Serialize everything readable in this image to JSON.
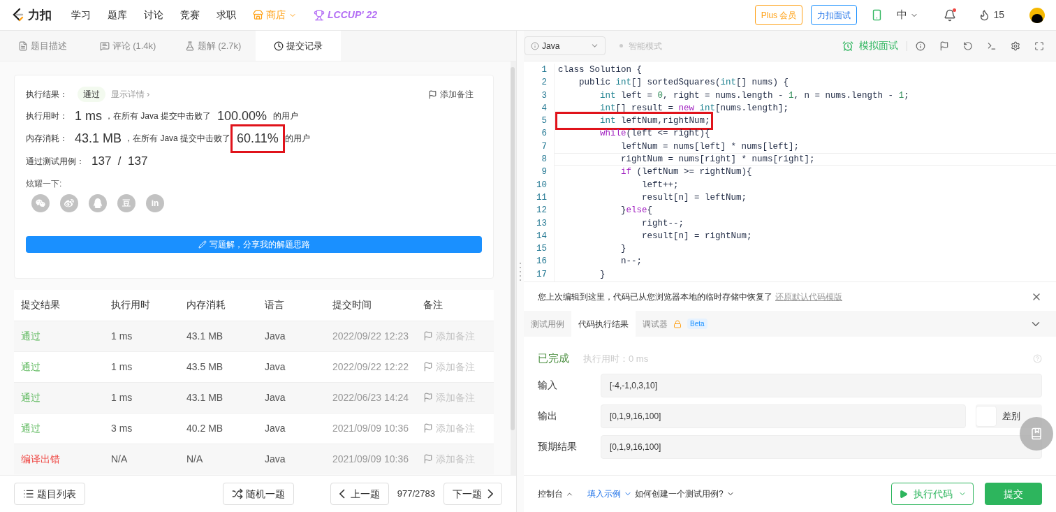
{
  "header": {
    "brand": "力扣",
    "nav": [
      {
        "label": "学习",
        "kind": "plain"
      },
      {
        "label": "题库",
        "kind": "plain"
      },
      {
        "label": "讨论",
        "kind": "plain"
      },
      {
        "label": "竞赛",
        "kind": "plain"
      },
      {
        "label": "求职",
        "kind": "plain"
      },
      {
        "label": "商店",
        "kind": "store"
      },
      {
        "label": "LCCUP' 22",
        "kind": "contest"
      }
    ],
    "plus": "Plus 会员",
    "interview": "力扣面试",
    "language": "中",
    "notification": true,
    "streak": "15"
  },
  "left_tabs": [
    {
      "label": "题目描述",
      "kind": "description",
      "selected": false
    },
    {
      "label": "评论 (1.4k)",
      "kind": "comments",
      "selected": false
    },
    {
      "label": "题解 (2.7k)",
      "kind": "solutions",
      "selected": false
    },
    {
      "label": "提交记录",
      "kind": "submissions",
      "selected": true
    }
  ],
  "result_card": {
    "result_label": "执行结果：",
    "result": "通过",
    "details": "显示详情 ›",
    "add_note": "添加备注",
    "stats": [
      {
        "label": "执行用时：",
        "value": "1 ms",
        "text": "，在所有 Java 提交中击败了",
        "percent": "100.00%",
        "suffix": "的用户",
        "highlighted": false
      },
      {
        "label": "内存消耗：",
        "value": "43.1 MB",
        "text": "，在所有 Java 提交中击败了",
        "percent": "60.11%",
        "suffix": "的用户",
        "highlighted": true
      }
    ],
    "cases_label": "通过测试用例：",
    "cases": "137  /  137",
    "share_label": "炫耀一下:",
    "share": [
      {
        "kind": "wechat"
      },
      {
        "kind": "weibo"
      },
      {
        "kind": "qq"
      },
      {
        "kind": "text",
        "label": "豆"
      },
      {
        "kind": "text",
        "label": "in"
      }
    ],
    "write_button": "写题解，分享我的解题思路"
  },
  "table": {
    "columns": [
      "提交结果",
      "执行用时",
      "内存消耗",
      "语言",
      "提交时间",
      "备注"
    ],
    "rows": [
      {
        "result": "通过",
        "color": "#5cb85c",
        "time": "1 ms",
        "memory": "43.1 MB",
        "language": "Java",
        "submitted": "2022/09/22 12:23",
        "note": "添加备注"
      },
      {
        "result": "通过",
        "color": "#5cb85c",
        "time": "1 ms",
        "memory": "43.5 MB",
        "language": "Java",
        "submitted": "2022/09/22 12:22",
        "note": "添加备注"
      },
      {
        "result": "通过",
        "color": "#5cb85c",
        "time": "1 ms",
        "memory": "43.1 MB",
        "language": "Java",
        "submitted": "2022/06/23 14:24",
        "note": "添加备注"
      },
      {
        "result": "通过",
        "color": "#5cb85c",
        "time": "3 ms",
        "memory": "40.2 MB",
        "language": "Java",
        "submitted": "2021/09/09 10:36",
        "note": "添加备注"
      },
      {
        "result": "编译出错",
        "color": "#ef4743",
        "time": "N/A",
        "memory": "N/A",
        "language": "Java",
        "submitted": "2021/09/09 10:36",
        "note": "添加备注"
      }
    ]
  },
  "left_footer": {
    "list": "题目列表",
    "random": "随机一题",
    "prev": "上一题",
    "progress": "977/2783",
    "next": "下一题"
  },
  "editor_toolbar": {
    "language": "Java",
    "mode": "智能模式",
    "mock": "模拟面试"
  },
  "code": [
    {
      "number": "1",
      "current": false,
      "highlighted": false,
      "tokens": [
        {
          "text": "class Solution {",
          "kind": "plain"
        }
      ]
    },
    {
      "number": "2",
      "current": false,
      "highlighted": false,
      "tokens": [
        {
          "text": "    public ",
          "kind": "plain"
        },
        {
          "text": "int",
          "kind": "type"
        },
        {
          "text": "[] sortedSquares(",
          "kind": "plain"
        },
        {
          "text": "int",
          "kind": "type"
        },
        {
          "text": "[] nums) {",
          "kind": "plain"
        }
      ]
    },
    {
      "number": "3",
      "current": false,
      "highlighted": false,
      "tokens": [
        {
          "text": "        int",
          "kind": "type"
        },
        {
          "text": " left = ",
          "kind": "plain"
        },
        {
          "text": "0",
          "kind": "number"
        },
        {
          "text": ", right = nums.length - ",
          "kind": "plain"
        },
        {
          "text": "1",
          "kind": "number"
        },
        {
          "text": ", n = nums.length - ",
          "kind": "plain"
        },
        {
          "text": "1",
          "kind": "number"
        },
        {
          "text": ";",
          "kind": "plain"
        }
      ]
    },
    {
      "number": "4",
      "current": false,
      "highlighted": false,
      "tokens": [
        {
          "text": "        int",
          "kind": "type"
        },
        {
          "text": "[] result = ",
          "kind": "plain"
        },
        {
          "text": "new",
          "kind": "keyword"
        },
        {
          "text": " int",
          "kind": "type"
        },
        {
          "text": "[nums.length];",
          "kind": "plain"
        }
      ]
    },
    {
      "number": "5",
      "current": false,
      "highlighted": true,
      "tokens": [
        {
          "text": "        int",
          "kind": "type"
        },
        {
          "text": " leftNum,rightNum;",
          "kind": "plain"
        }
      ]
    },
    {
      "number": "6",
      "current": false,
      "highlighted": false,
      "tokens": [
        {
          "text": "        while",
          "kind": "keyword"
        },
        {
          "text": "(left <= right){",
          "kind": "plain"
        }
      ]
    },
    {
      "number": "7",
      "current": false,
      "highlighted": false,
      "tokens": [
        {
          "text": "            leftNum = nums[left] * nums[left];",
          "kind": "plain"
        }
      ]
    },
    {
      "number": "8",
      "current": true,
      "highlighted": false,
      "tokens": [
        {
          "text": "            rightNum = nums[right] * nums[right];",
          "kind": "plain"
        }
      ]
    },
    {
      "number": "9",
      "current": false,
      "highlighted": false,
      "tokens": [
        {
          "text": "            if",
          "kind": "keyword"
        },
        {
          "text": " (leftNum >= rightNum){",
          "kind": "plain"
        }
      ]
    },
    {
      "number": "10",
      "current": false,
      "highlighted": false,
      "tokens": [
        {
          "text": "                left++;",
          "kind": "plain"
        }
      ]
    },
    {
      "number": "11",
      "current": false,
      "highlighted": false,
      "tokens": [
        {
          "text": "                result[n] = leftNum;",
          "kind": "plain"
        }
      ]
    },
    {
      "number": "12",
      "current": false,
      "highlighted": false,
      "tokens": [
        {
          "text": "            }",
          "kind": "plain"
        },
        {
          "text": "else",
          "kind": "keyword"
        },
        {
          "text": "{",
          "kind": "plain"
        }
      ]
    },
    {
      "number": "13",
      "current": false,
      "highlighted": false,
      "tokens": [
        {
          "text": "                right--;",
          "kind": "plain"
        }
      ]
    },
    {
      "number": "14",
      "current": false,
      "highlighted": false,
      "tokens": [
        {
          "text": "                result[n] = rightNum;",
          "kind": "plain"
        }
      ]
    },
    {
      "number": "15",
      "current": false,
      "highlighted": false,
      "tokens": [
        {
          "text": "            }",
          "kind": "plain"
        }
      ]
    },
    {
      "number": "16",
      "current": false,
      "highlighted": false,
      "tokens": [
        {
          "text": "            n--;",
          "kind": "plain"
        }
      ]
    },
    {
      "number": "17",
      "current": false,
      "highlighted": false,
      "tokens": [
        {
          "text": "        }",
          "kind": "plain"
        }
      ]
    }
  ],
  "notice": {
    "text": "您上次编辑到这里，代码已从您浏览器本地的临时存储中恢复了",
    "link": "还原默认代码模版"
  },
  "console_tabs": [
    {
      "label": "测试用例",
      "kind": "plain",
      "selected": false
    },
    {
      "label": "代码执行结果",
      "kind": "plain",
      "selected": true
    },
    {
      "label": "调试器",
      "kind": "debugger",
      "badge": "Beta",
      "selected": false
    }
  ],
  "run_result": {
    "status": "已完成",
    "runtime": "执行用时：0 ms",
    "fields": [
      {
        "label": "输入",
        "value": "[-4,-1,0,3,10]"
      },
      {
        "label": "输出",
        "value": "[0,1,9,16,100]",
        "diff": {
          "label": "差别",
          "checked": false
        }
      },
      {
        "label": "预期结果",
        "value": "[0,1,9,16,100]"
      }
    ]
  },
  "right_footer": {
    "console": "控制台",
    "example": "填入示例",
    "howto": "如何创建一个测试用例?",
    "run": "执行代码",
    "submit": "提交"
  }
}
